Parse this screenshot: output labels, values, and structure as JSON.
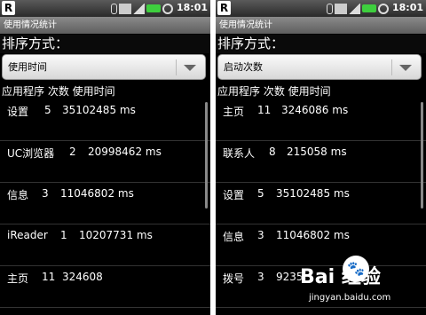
{
  "status": {
    "badge": "R",
    "time": "18:01"
  },
  "screens": [
    {
      "title": "使用情况统计",
      "sort_label": "排序方式：",
      "sort_value": "使用时间",
      "header": "应用程序 次数 使用时间",
      "rows": [
        {
          "name": "设置",
          "count": "5",
          "time": "35102485 ms"
        },
        {
          "name": "UC浏览器",
          "count": "2",
          "time": "20998462 ms"
        },
        {
          "name": "信息",
          "count": "3",
          "time": "11046802 ms"
        },
        {
          "name": "iReader",
          "count": "1",
          "time": "10207731 ms"
        },
        {
          "name": "主页",
          "count": "11",
          "time": "324608"
        }
      ]
    },
    {
      "title": "使用情况统计",
      "sort_label": "排序方式：",
      "sort_value": "启动次数",
      "header": "应用程序 次数 使用时间",
      "rows": [
        {
          "name": "主页",
          "count": "11",
          "time": "3246086 ms"
        },
        {
          "name": "联系人",
          "count": "8",
          "time": "215058 ms"
        },
        {
          "name": "设置",
          "count": "5",
          "time": "35102485 ms"
        },
        {
          "name": "信息",
          "count": "3",
          "time": "11046802 ms"
        },
        {
          "name": "拨号",
          "count": "3",
          "time": "9235"
        }
      ]
    }
  ],
  "watermark": {
    "main": "Bai  经验",
    "sub": "jingyan.baidu.com"
  }
}
